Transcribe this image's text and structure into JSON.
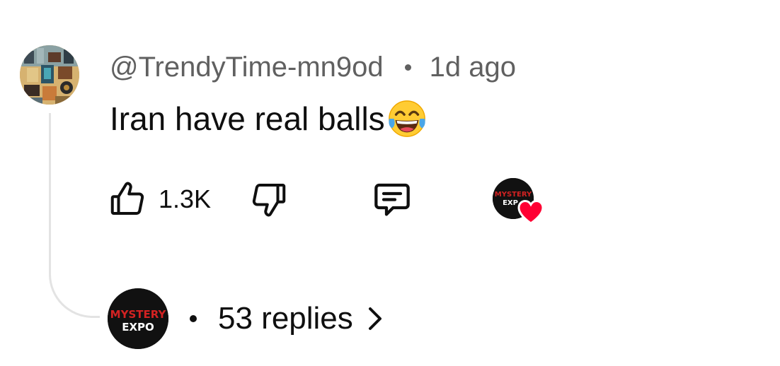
{
  "comment": {
    "author": "@TrendyTime-mn9od",
    "separator": "•",
    "time": "1d ago",
    "text": "Iran have real balls",
    "emoji": "face-with-tears-of-joy-icon"
  },
  "actions": {
    "like_count": "1.3K",
    "like_icon": "thumbs-up-icon",
    "dislike_icon": "thumbs-down-icon",
    "reply_icon": "comment-icon",
    "creator_heart_icon": "heart-icon"
  },
  "creator": {
    "logo_line1": "MYSTERY",
    "logo_line2": "EXPO",
    "small_logo_line1": "MYSTERY",
    "small_logo_line2": "EXP"
  },
  "replies": {
    "label": "53 replies",
    "chevron_icon": "chevron-right-icon"
  },
  "colors": {
    "text_primary": "#0f0f0f",
    "text_secondary": "#606060",
    "thread_line": "#e3e3e3",
    "heart": "#ff0033",
    "logo_red": "#d32222",
    "logo_white": "#ffffff"
  }
}
